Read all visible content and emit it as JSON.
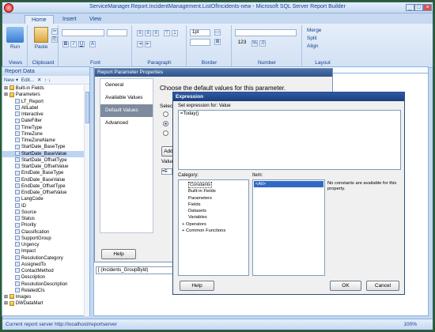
{
  "window": {
    "title": "ServiceManager.Report.IncidentManagement.ListOfIncidents-new - Microsoft SQL Server Report Builder",
    "controls": [
      "_",
      "□",
      "×"
    ]
  },
  "ribbon": {
    "tabs": [
      "Home",
      "Insert",
      "View"
    ],
    "groups": {
      "views": "Views",
      "clipboard": "Clipboard",
      "font": "Font",
      "paragraph": "Paragraph",
      "border": "Border",
      "number": "Number",
      "layout": "Layout"
    },
    "run_label": "Run",
    "paste_label": "Paste",
    "border_size": "1pt",
    "number_format": "123",
    "merge": "Merge",
    "split": "Split",
    "align": "Align"
  },
  "report_data": {
    "title": "Report Data",
    "toolbar": {
      "new": "New",
      "edit": "Edit...",
      "delete": "✕",
      "up": "↑",
      "down": "↓"
    },
    "items": [
      {
        "label": "Built-in Fields",
        "type": "folder",
        "level": 0
      },
      {
        "label": "Parameters",
        "type": "folder",
        "level": 0
      },
      {
        "label": "LT_Report",
        "type": "param",
        "level": 1
      },
      {
        "label": "AllLabel",
        "type": "param",
        "level": 1
      },
      {
        "label": "Interactive",
        "type": "param",
        "level": 1
      },
      {
        "label": "DateFilter",
        "type": "param",
        "level": 1
      },
      {
        "label": "TimeType",
        "type": "param",
        "level": 1
      },
      {
        "label": "TimeZone",
        "type": "param",
        "level": 1
      },
      {
        "label": "TimeZoneName",
        "type": "param",
        "level": 1
      },
      {
        "label": "StartDate_BaseType",
        "type": "param",
        "level": 1
      },
      {
        "label": "StartDate_BaseValue",
        "type": "param",
        "level": 1,
        "selected": true
      },
      {
        "label": "StartDate_OffsetType",
        "type": "param",
        "level": 1
      },
      {
        "label": "StartDate_OffsetValue",
        "type": "param",
        "level": 1
      },
      {
        "label": "EndDate_BaseType",
        "type": "param",
        "level": 1
      },
      {
        "label": "EndDate_BaseValue",
        "type": "param",
        "level": 1
      },
      {
        "label": "EndDate_OffsetType",
        "type": "param",
        "level": 1
      },
      {
        "label": "EndDate_OffsetValue",
        "type": "param",
        "level": 1
      },
      {
        "label": "LangCode",
        "type": "param",
        "level": 1
      },
      {
        "label": "ID",
        "type": "param",
        "level": 1
      },
      {
        "label": "Source",
        "type": "param",
        "level": 1
      },
      {
        "label": "Status",
        "type": "param",
        "level": 1
      },
      {
        "label": "Priority",
        "type": "param",
        "level": 1
      },
      {
        "label": "Classification",
        "type": "param",
        "level": 1
      },
      {
        "label": "SupportGroup",
        "type": "param",
        "level": 1
      },
      {
        "label": "Urgency",
        "type": "param",
        "level": 1
      },
      {
        "label": "Impact",
        "type": "param",
        "level": 1
      },
      {
        "label": "ResolutionCategory",
        "type": "param",
        "level": 1
      },
      {
        "label": "AssignedTo",
        "type": "param",
        "level": 1
      },
      {
        "label": "ContactMethod",
        "type": "param",
        "level": 1
      },
      {
        "label": "Description",
        "type": "param",
        "level": 1
      },
      {
        "label": "ResolutionDescription",
        "type": "param",
        "level": 1
      },
      {
        "label": "RelatedCIs",
        "type": "param",
        "level": 1
      },
      {
        "label": "Images",
        "type": "folder",
        "level": 0
      },
      {
        "label": "DWDataMart",
        "type": "folder",
        "level": 0
      }
    ]
  },
  "param_dialog": {
    "title": "Report Parameter Properties",
    "nav": [
      "General",
      "Available Values",
      "Default Values",
      "Advanced"
    ],
    "heading": "Choose the default values for this parameter.",
    "select_label": "Select",
    "add_button": "Add",
    "value_label": "Value",
    "value_text": "=E",
    "help": "Help"
  },
  "design_field": "[ (Incidents_GroupById)",
  "expr_dialog": {
    "title": "Expression",
    "set_label": "Set expression for: Value",
    "expression": "=Today()",
    "category_label": "Category:",
    "item_label": "Item:",
    "categories": [
      {
        "label": "Constants",
        "level": 0,
        "selected": true
      },
      {
        "label": "Built-in Fields",
        "level": 0
      },
      {
        "label": "Parameters",
        "level": 0
      },
      {
        "label": "Fields",
        "level": 0
      },
      {
        "label": "Datasets",
        "level": 0
      },
      {
        "label": "Variables",
        "level": 0
      },
      {
        "label": "Operators",
        "level": 0,
        "expander": "+"
      },
      {
        "label": "Common Functions",
        "level": 0,
        "expander": "+"
      }
    ],
    "items": [
      "<All>"
    ],
    "description": "No constants are available for this property.",
    "help": "Help",
    "ok": "OK",
    "cancel": "Cancel"
  },
  "status": {
    "text": "Current report server http://localhost/reportserver",
    "zoom": "100%"
  }
}
